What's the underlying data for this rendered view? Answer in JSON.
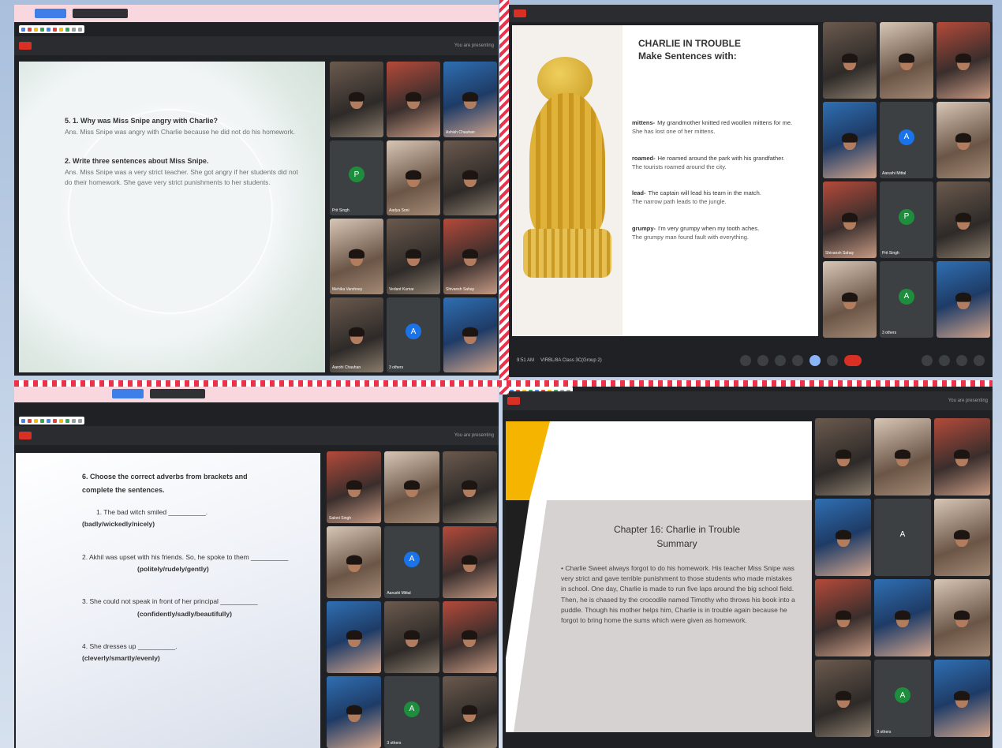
{
  "q1": {
    "tools_label": "",
    "presenting": "You are presenting",
    "slide_label": "",
    "q5_title": "5. 1. Why was Miss Snipe angry with Charlie?",
    "q5_answer": "Ans. Miss Snipe was angry with Charlie because he did not do his homework.",
    "q2_title": "2. Write three sentences about Miss Snipe.",
    "q2_answer": "Ans. Miss Snipe was a very strict teacher. She got angry if her students did not do their homework. She gave very strict punishments to her students.",
    "tiles": [
      {
        "name": "",
        "kind": "cam"
      },
      {
        "name": "",
        "kind": "cam2"
      },
      {
        "name": "Ashish Chauhan",
        "kind": "cam3"
      },
      {
        "name": "Prit Singh",
        "kind": "avatar",
        "letter": "P",
        "color": "#1e8e3e"
      },
      {
        "name": "Aadya Soni",
        "kind": "cam4"
      },
      {
        "name": "",
        "kind": "cam"
      },
      {
        "name": "Mehika Varshney",
        "kind": "cam4"
      },
      {
        "name": "Vedant Kumar",
        "kind": "cam"
      },
      {
        "name": "Shivansh Sahay",
        "kind": "cam2"
      },
      {
        "name": "Aarohi Chauhan",
        "kind": "cam"
      },
      {
        "name": "3 others",
        "kind": "avatar",
        "letter": "A",
        "color": "#1a73e8"
      },
      {
        "name": "",
        "kind": "cam3"
      }
    ]
  },
  "q2": {
    "slide_title": "CHARLIE IN TROUBLE",
    "slide_subtitle": "Make Sentences with:",
    "words": [
      {
        "word": "mittens-",
        "l1": "My grandmother knitted red woollen mittens for me.",
        "l2": "She has lost one of her mittens."
      },
      {
        "word": "roamed-",
        "l1": "He roamed around the park with his grandfather.",
        "l2": "The tourists roamed around the city."
      },
      {
        "word": "lead-",
        "l1": "The captain will lead his team in the match.",
        "l2": "The narrow path leads to the jungle."
      },
      {
        "word": "grumpy-",
        "l1": "I'm very grumpy when my tooth aches.",
        "l2": "The grumpy man found fault with everything."
      }
    ],
    "time": "9:51 AM",
    "meeting": "VIRBL/8A Class 3C(Group 2)",
    "tiles": [
      {
        "name": "",
        "kind": "cam"
      },
      {
        "name": "",
        "kind": "cam4"
      },
      {
        "name": "",
        "kind": "cam2"
      },
      {
        "name": "",
        "kind": "cam3"
      },
      {
        "name": "Aarushi Mittal",
        "kind": "avatar",
        "letter": "A",
        "color": "#1a73e8"
      },
      {
        "name": "",
        "kind": "cam4"
      },
      {
        "name": "Shivansh Sahay",
        "kind": "cam2"
      },
      {
        "name": "Prit Singh",
        "kind": "avatar",
        "letter": "P",
        "color": "#1e8e3e"
      },
      {
        "name": "",
        "kind": "cam"
      },
      {
        "name": "",
        "kind": "cam4"
      },
      {
        "name": "3 others",
        "kind": "avatar",
        "letter": "A",
        "color": "#1e8e3e"
      },
      {
        "name": "",
        "kind": "cam3"
      }
    ]
  },
  "q3": {
    "presenting": "You are presenting",
    "title": "6. Choose the correct adverbs from brackets and complete the sentences.",
    "items": [
      {
        "line": "1. The bad witch smiled __________.",
        "options": "(badly/wickedly/nicely)"
      },
      {
        "line": "2. Akhil was upset with his friends. So, he spoke to them __________",
        "options": "(politely/rudely/gently)"
      },
      {
        "line": "3. She could not speak in front of her principal __________",
        "options": "(confidently/sadly/beautifully)"
      },
      {
        "line": "4. She dresses up __________.",
        "options": "(cleverly/smartly/evenly)"
      }
    ],
    "tiles": [
      {
        "name": "Saloni Singh",
        "kind": "cam2"
      },
      {
        "name": "",
        "kind": "cam4"
      },
      {
        "name": "",
        "kind": "cam"
      },
      {
        "name": "",
        "kind": "cam4"
      },
      {
        "name": "Aarushi Mittal",
        "kind": "avatar",
        "letter": "A",
        "color": "#1a73e8"
      },
      {
        "name": "",
        "kind": "cam2"
      },
      {
        "name": "",
        "kind": "cam3"
      },
      {
        "name": "",
        "kind": "cam"
      },
      {
        "name": "",
        "kind": "cam2"
      },
      {
        "name": "",
        "kind": "cam3"
      },
      {
        "name": "3 others",
        "kind": "avatar",
        "letter": "A",
        "color": "#1e8e3e"
      },
      {
        "name": "",
        "kind": "cam"
      }
    ]
  },
  "q4": {
    "presenting": "You are presenting",
    "heading": "Chapter 16: Charlie in Trouble",
    "subheading": "Summary",
    "body": "• Charlie Sweet always forgot to do his homework. His teacher Miss Snipe was very strict and gave terrible punishment to those students who made mistakes in school. One day, Charlie is made to run five laps around the big school field. Then, he is chased by the crocodile named Timothy who throws his book into a puddle. Though his mother helps him, Charlie is in trouble again because he forgot to bring home the sums which were given as homework.",
    "tiles": [
      {
        "name": "",
        "kind": "cam"
      },
      {
        "name": "",
        "kind": "cam4"
      },
      {
        "name": "",
        "kind": "cam2"
      },
      {
        "name": "",
        "kind": "cam3"
      },
      {
        "name": "",
        "kind": "avatar",
        "letter": "A",
        "color": "#3c4043"
      },
      {
        "name": "",
        "kind": "cam4"
      },
      {
        "name": "",
        "kind": "cam2"
      },
      {
        "name": "",
        "kind": "cam3"
      },
      {
        "name": "",
        "kind": "cam4"
      },
      {
        "name": "",
        "kind": "cam"
      },
      {
        "name": "3 others",
        "kind": "avatar",
        "letter": "A",
        "color": "#1e8e3e"
      },
      {
        "name": "",
        "kind": "cam3"
      }
    ]
  },
  "colors": {
    "accent_yellow": "#f5b400",
    "rec_red": "#d93025",
    "meet_blue": "#1a73e8"
  }
}
